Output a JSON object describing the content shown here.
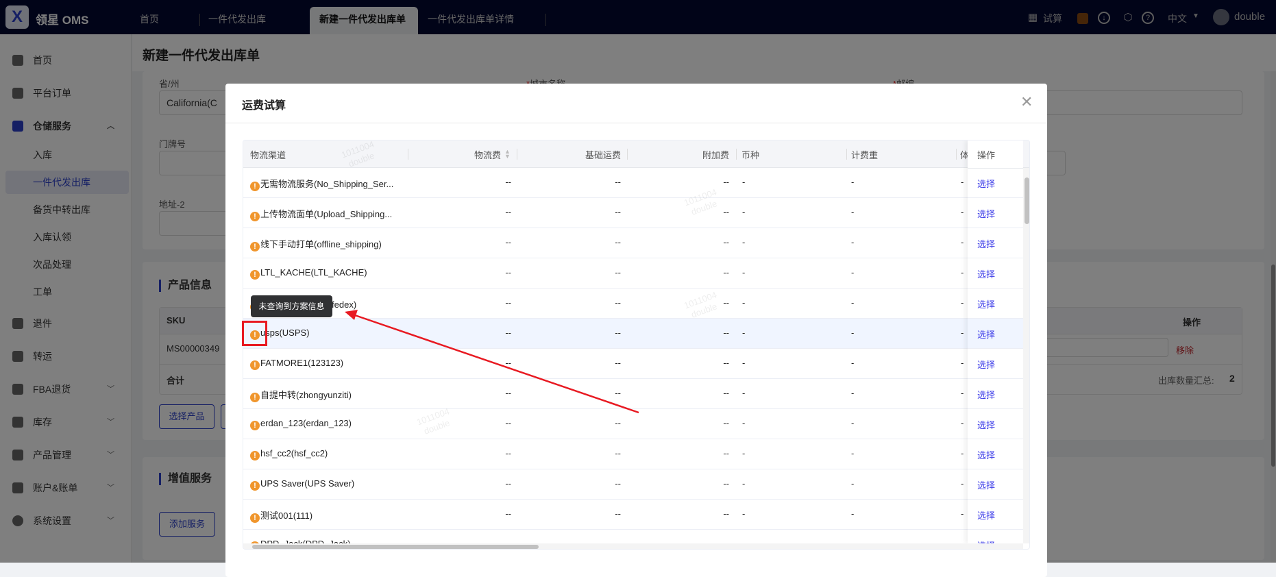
{
  "topbar": {
    "brand": "领星 OMS",
    "tabs": [
      {
        "label": "首页",
        "active": false
      },
      {
        "label": "一件代发出库",
        "active": false
      },
      {
        "label": "新建一件代发出库单",
        "active": true
      },
      {
        "label": "一件代发出库单详情",
        "active": false
      }
    ],
    "calc_label": "试算",
    "lang": "中文",
    "user": "double"
  },
  "sidebar": {
    "items": [
      {
        "label": "首页"
      },
      {
        "label": "平台订单"
      },
      {
        "label": "仓储服务",
        "expanded": true
      },
      {
        "label": "退件"
      },
      {
        "label": "转运"
      },
      {
        "label": "FBA退货"
      },
      {
        "label": "库存"
      },
      {
        "label": "产品管理"
      },
      {
        "label": "账户&账单"
      },
      {
        "label": "系统设置"
      }
    ],
    "sub_items": [
      "入库",
      "一件代发出库",
      "备货中转出库",
      "入库认领",
      "次品处理",
      "工单"
    ],
    "active_sub": "一件代发出库"
  },
  "page": {
    "title": "新建一件代发出库单",
    "form": {
      "state_label": "省/州",
      "state_value": "California(C",
      "city_label": "城市名称",
      "zip_label": "邮编",
      "required_mark": "*",
      "door_label": "门牌号",
      "addr2_label": "地址-2"
    },
    "product": {
      "title": "产品信息",
      "sku_header": "SKU",
      "op_header": "操作",
      "sku": "MS00000349",
      "remove": "移除",
      "total_label": "合计",
      "qty_summary_label": "出库数量汇总:",
      "qty_summary_value": "2",
      "select_product": "选择产品"
    },
    "value_added": {
      "title": "增值服务",
      "add_service": "添加服务"
    }
  },
  "modal": {
    "title": "运费试算",
    "columns": [
      "物流渠道",
      "物流费",
      "基础运费",
      "附加费",
      "币种",
      "计费重",
      "体",
      "操作"
    ],
    "rows": [
      {
        "channel": "无需物流服务(No_Shipping_Ser...",
        "fee": "--",
        "base": "--",
        "extra": "--",
        "currency": "-",
        "weight": "-",
        "vol": "-",
        "action": "选择"
      },
      {
        "channel": "上传物流面单(Upload_Shipping...",
        "fee": "--",
        "base": "--",
        "extra": "--",
        "currency": "-",
        "weight": "-",
        "vol": "-",
        "action": "选择"
      },
      {
        "channel": "线下手动打单(offline_shipping)",
        "fee": "--",
        "base": "--",
        "extra": "--",
        "currency": "-",
        "weight": "-",
        "vol": "-",
        "action": "选择"
      },
      {
        "channel": "LTL_KACHE(LTL_KACHE)",
        "fee": "--",
        "base": "--",
        "extra": "--",
        "currency": "-",
        "weight": "-",
        "vol": "-",
        "action": "选择"
      },
      {
        "channel": "二级_联邦(erdan_fedex)",
        "fee": "--",
        "base": "--",
        "extra": "--",
        "currency": "-",
        "weight": "-",
        "vol": "-",
        "action": "选择"
      },
      {
        "channel": "usps(USPS)",
        "fee": "--",
        "base": "--",
        "extra": "--",
        "currency": "-",
        "weight": "-",
        "vol": "-",
        "action": "选择"
      },
      {
        "channel": "FATMORE1(123123)",
        "fee": "--",
        "base": "--",
        "extra": "--",
        "currency": "-",
        "weight": "-",
        "vol": "-",
        "action": "选择"
      },
      {
        "channel": "自提中转(zhongyunziti)",
        "fee": "--",
        "base": "--",
        "extra": "--",
        "currency": "-",
        "weight": "-",
        "vol": "-",
        "action": "选择"
      },
      {
        "channel": "erdan_123(erdan_123)",
        "fee": "--",
        "base": "--",
        "extra": "--",
        "currency": "-",
        "weight": "-",
        "vol": "-",
        "action": "选择"
      },
      {
        "channel": "hsf_cc2(hsf_cc2)",
        "fee": "--",
        "base": "--",
        "extra": "--",
        "currency": "-",
        "weight": "-",
        "vol": "-",
        "action": "选择"
      },
      {
        "channel": "UPS Saver(UPS Saver)",
        "fee": "--",
        "base": "--",
        "extra": "--",
        "currency": "-",
        "weight": "-",
        "vol": "-",
        "action": "选择"
      },
      {
        "channel": "测试001(111)",
        "fee": "--",
        "base": "--",
        "extra": "--",
        "currency": "-",
        "weight": "-",
        "vol": "-",
        "action": "选择"
      },
      {
        "channel": "DPD_Jack(DPD_Jack)",
        "fee": "--",
        "base": "--",
        "extra": "--",
        "currency": "-",
        "weight": "-",
        "vol": "-",
        "action": "选择"
      }
    ],
    "hover_row": 5,
    "tooltip": "未查询到方案信息",
    "warn_icon": "!"
  },
  "watermark": {
    "line1": "1011004",
    "line2": "double"
  },
  "colors": {
    "accent": "#2a3ec8",
    "warn": "#f0962d",
    "link": "#3a3ae8",
    "danger": "#c0272d",
    "annotation": "#e81a22"
  }
}
